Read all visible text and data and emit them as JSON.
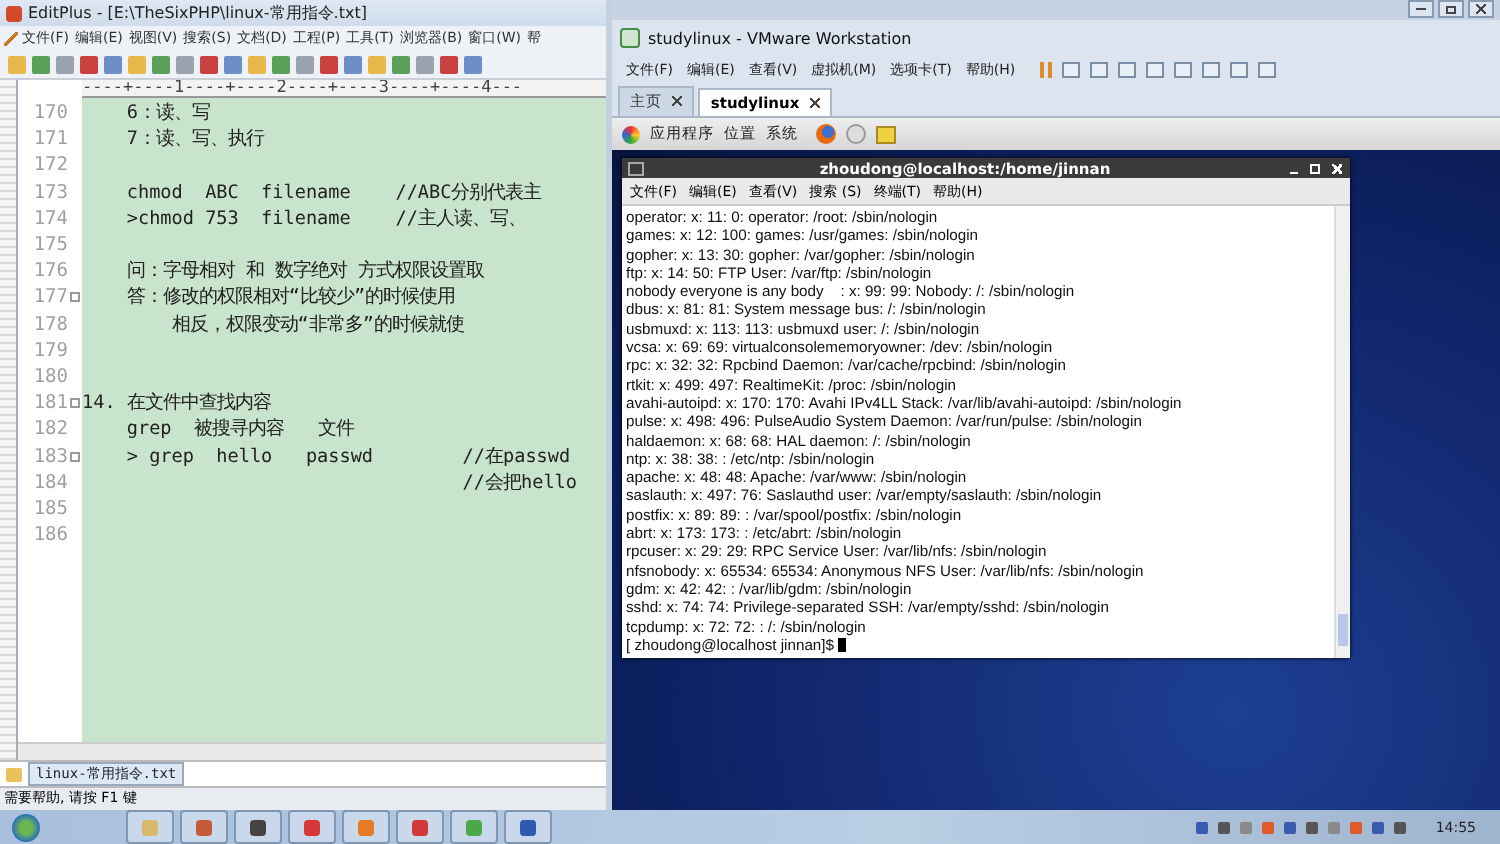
{
  "editplus": {
    "title": "EditPlus - [E:\\TheSixPHP\\linux-常用指令.txt]",
    "menu": [
      "文件(F)",
      "编辑(E)",
      "视图(V)",
      "搜索(S)",
      "文档(D)",
      "工程(P)",
      "工具(T)",
      "浏览器(B)",
      "窗口(W)",
      "帮"
    ],
    "ruler": "----+----1----+----2----+----3----+----4---",
    "lines": [
      {
        "number": "170",
        "text": "    6：读、写",
        "fold": false
      },
      {
        "number": "171",
        "text": "    7：读、写、执行",
        "fold": false
      },
      {
        "number": "172",
        "fold": false
      },
      {
        "number": "173",
        "text": "    chmod  ABC  filename    //ABC分别代表主",
        "fold": false
      },
      {
        "number": "174",
        "text": "    >chmod 753  filename    //主人读、写、",
        "fold": false
      },
      {
        "number": "175",
        "fold": false
      },
      {
        "number": "176",
        "text": "    问：字母相对 和 数字绝对 方式权限设置取",
        "fold": false
      },
      {
        "number": "177",
        "text": "    答：修改的权限相对“比较少”的时候使用",
        "fold": true
      },
      {
        "number": "178",
        "text": "        相反，权限变动“非常多”的时候就使",
        "fold": false
      },
      {
        "number": "179",
        "fold": false
      },
      {
        "number": "180",
        "fold": false
      },
      {
        "number": "181",
        "text": "14. 在文件中查找内容",
        "fold": true
      },
      {
        "number": "182",
        "text": "    grep  被搜寻内容   文件",
        "fold": false
      },
      {
        "number": "183",
        "text": "    > grep  hello   passwd        //在passwd",
        "fold": true
      },
      {
        "number": "184",
        "text": "                                  //会把hello",
        "fold": false
      },
      {
        "number": "185",
        "fold": false
      },
      {
        "number": "186",
        "fold": false
      }
    ],
    "file_tab": "linux-常用指令.txt",
    "status": "需要帮助, 请按 F1 键"
  },
  "vmware": {
    "title": "studylinux - VMware Workstation",
    "menu": [
      "文件(F)",
      "编辑(E)",
      "查看(V)",
      "虚拟机(M)",
      "选项卡(T)",
      "帮助(H)"
    ],
    "tabs": [
      {
        "label": "主页",
        "selected": false
      },
      {
        "label": "studylinux",
        "selected": true
      }
    ],
    "panel_menu": [
      "应用程序",
      "位置",
      "系统"
    ],
    "terminal": {
      "title": "zhoudong@localhost:/home/jinnan",
      "menu": [
        "文件(F)",
        "编辑(E)",
        "查看(V)",
        "搜索 (S)",
        "终端(T)",
        "帮助(H)"
      ],
      "lines": [
        "operator: x: 11: 0: operator: /root: /sbin/nologin",
        "games: x: 12: 100: games: /usr/games: /sbin/nologin",
        "gopher: x: 13: 30: gopher: /var/gopher: /sbin/nologin",
        "ftp: x: 14: 50: FTP User: /var/ftp: /sbin/nologin",
        "nobody everyone is any body    : x: 99: 99: Nobody: /: /sbin/nologin",
        "dbus: x: 81: 81: System message bus: /: /sbin/nologin",
        "usbmuxd: x: 113: 113: usbmuxd user: /: /sbin/nologin",
        "vcsa: x: 69: 69: virtualconsolememoryowner: /dev: /sbin/nologin",
        "rpc: x: 32: 32: Rpcbind Daemon: /var/cache/rpcbind: /sbin/nologin",
        "rtkit: x: 499: 497: RealtimeKit: /proc: /sbin/nologin",
        "avahi-autoipd: x: 170: 170: Avahi IPv4LL Stack: /var/lib/avahi-autoipd: /sbin/nologin",
        "pulse: x: 498: 496: PulseAudio System Daemon: /var/run/pulse: /sbin/nologin",
        "haldaemon: x: 68: 68: HAL daemon: /: /sbin/nologin",
        "ntp: x: 38: 38: : /etc/ntp: /sbin/nologin",
        "apache: x: 48: 48: Apache: /var/www: /sbin/nologin",
        "saslauth: x: 497: 76: Saslauthd user: /var/empty/saslauth: /sbin/nologin",
        "postfix: x: 89: 89: : /var/spool/postfix: /sbin/nologin",
        "abrt: x: 173: 173: : /etc/abrt: /sbin/nologin",
        "rpcuser: x: 29: 29: RPC Service User: /var/lib/nfs: /sbin/nologin",
        "nfsnobody: x: 65534: 65534: Anonymous NFS User: /var/lib/nfs: /sbin/nologin",
        "gdm: x: 42: 42: : /var/lib/gdm: /sbin/nologin",
        "sshd: x: 74: 74: Privilege-separated SSH: /var/empty/sshd: /sbin/nologin",
        "tcpdump: x: 72: 72: : /: /sbin/nologin"
      ],
      "prompt": "[ zhoudong@localhost jinnan]$"
    }
  },
  "taskbar": {
    "clock": "14:55"
  }
}
